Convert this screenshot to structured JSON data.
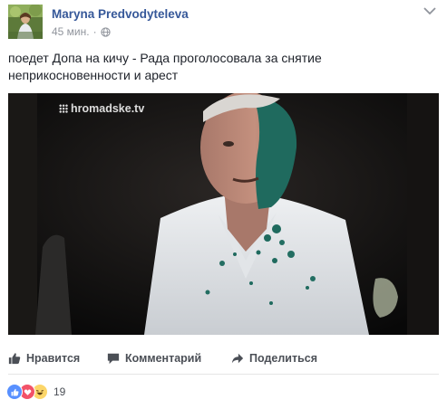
{
  "post": {
    "author": "Maryna Predvodyteleva",
    "time": "45 мин.",
    "separator": "·",
    "text_line1": "поедет Допа на кичу - Рада проголосовала за снятие",
    "text_line2": "неприкосновенности и арест"
  },
  "media": {
    "watermark": "hromadske.tv"
  },
  "actions": {
    "like_label": "Нравится",
    "comment_label": "Комментарий",
    "share_label": "Поделиться"
  },
  "reactions": {
    "count": "19",
    "types": [
      "like",
      "love",
      "haha"
    ]
  },
  "colors": {
    "link": "#365899",
    "like_blue": "#5890ff",
    "love_red": "#f25268",
    "haha_yellow": "#fcd669"
  }
}
